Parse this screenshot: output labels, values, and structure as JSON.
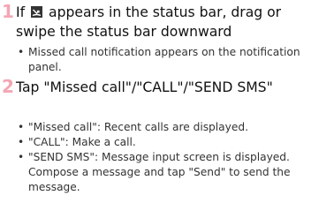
{
  "accent_color": "#f4a6b3",
  "steps": [
    {
      "number": "1",
      "title_before_icon": "If",
      "icon": "missed-call-icon",
      "title_after_icon": "appears in the status bar, drag or swipe the status bar downward",
      "bullets": [
        "Missed call notification appears on the notification panel."
      ]
    },
    {
      "number": "2",
      "title": "Tap \"Missed call\"/\"CALL\"/\"SEND SMS\"",
      "bullets": [
        "\"Missed call\": Recent calls are displayed.",
        "\"CALL\": Make a call.",
        "\"SEND SMS\": Message input screen is displayed. Compose a message and tap \"Send\" to send the message."
      ]
    }
  ]
}
